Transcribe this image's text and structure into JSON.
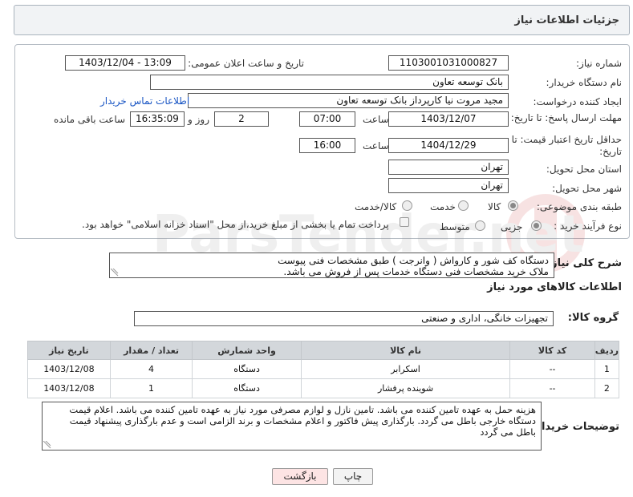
{
  "header": {
    "title": "جزئیات اطلاعات نیاز"
  },
  "form": {
    "need_number_label": "شماره نیاز:",
    "need_number": "1103001031000827",
    "announce_label": "تاریخ و ساعت اعلان عمومی:",
    "announce_value": "1403/12/04 - 13:09",
    "buyer_org_label": "نام دستگاه خریدار:",
    "buyer_org": "بانک توسعه تعاون",
    "creator_label": "ایجاد کننده درخواست:",
    "creator": "مجید مروت نیا کارپرداز بانک توسعه تعاون",
    "contact_link": "اطلاعات تماس خریدار",
    "reply_deadline_label": "مهلت ارسال پاسخ: تا تاریخ:",
    "reply_date": "1403/12/07",
    "time_label": "ساعت",
    "reply_time": "07:00",
    "days_value": "2",
    "days_label": "روز و",
    "remaining_time": "16:35:09",
    "remaining_label": "ساعت باقی مانده",
    "price_deadline_label": "حداقل تاریخ اعتبار قیمت: تا تاریخ:",
    "price_date": "1404/12/29",
    "price_time": "16:00",
    "province_label": "استان محل تحویل:",
    "province": "تهران",
    "city_label": "شهر محل تحویل:",
    "city": "تهران",
    "category_label": "طبقه بندی موضوعی:",
    "category_options": [
      "کالا",
      "خدمت",
      "کالا/خدمت"
    ],
    "purchase_label": "نوع فرآیند خرید :",
    "purchase_options": [
      "جزیی",
      "متوسط"
    ],
    "payment_note": "پرداخت تمام یا بخشی از مبلغ خرید،از محل \"اسناد خزانه اسلامی\" خواهد بود."
  },
  "summary": {
    "label": "شرح کلی نیاز:",
    "line1": "دستگاه کف شور و کارواش ( وانرجت ) طبق مشخصات فنی پیوست",
    "line2": "ملاک خرید مشخصات فنی دستگاه خدمات پس از فروش می باشد."
  },
  "goods": {
    "section_title": "اطلاعات کالاهای مورد نیاز",
    "group_label": "گروه کالا:",
    "group_value": "تجهیزات خانگی، اداری و صنعتی",
    "columns": [
      "ردیف",
      "کد کالا",
      "نام کالا",
      "واحد شمارش",
      "تعداد / مقدار",
      "تاریخ نیاز"
    ],
    "rows": [
      [
        "1",
        "--",
        "اسکرابر",
        "دستگاه",
        "4",
        "1403/12/08"
      ],
      [
        "2",
        "--",
        "شوینده پرفشار",
        "دستگاه",
        "1",
        "1403/12/08"
      ]
    ]
  },
  "buyer_notes": {
    "label": "توضیحات خریدار:",
    "text": "هزینه حمل به عهده تامین کننده می باشد. تامین نازل و لوازم مصرفی مورد نیاز به عهده تامین کننده می باشد. اعلام قیمت دستگاه خارجی باطل می گردد. بارگذاری پیش فاکتور و اعلام مشخصات و برند الزامی است و عدم بارگذاری پیشنهاد قیمت باطل می گردد"
  },
  "buttons": {
    "print": "چاپ",
    "back": "بازگشت"
  },
  "watermark_text": "ParsTender.net"
}
